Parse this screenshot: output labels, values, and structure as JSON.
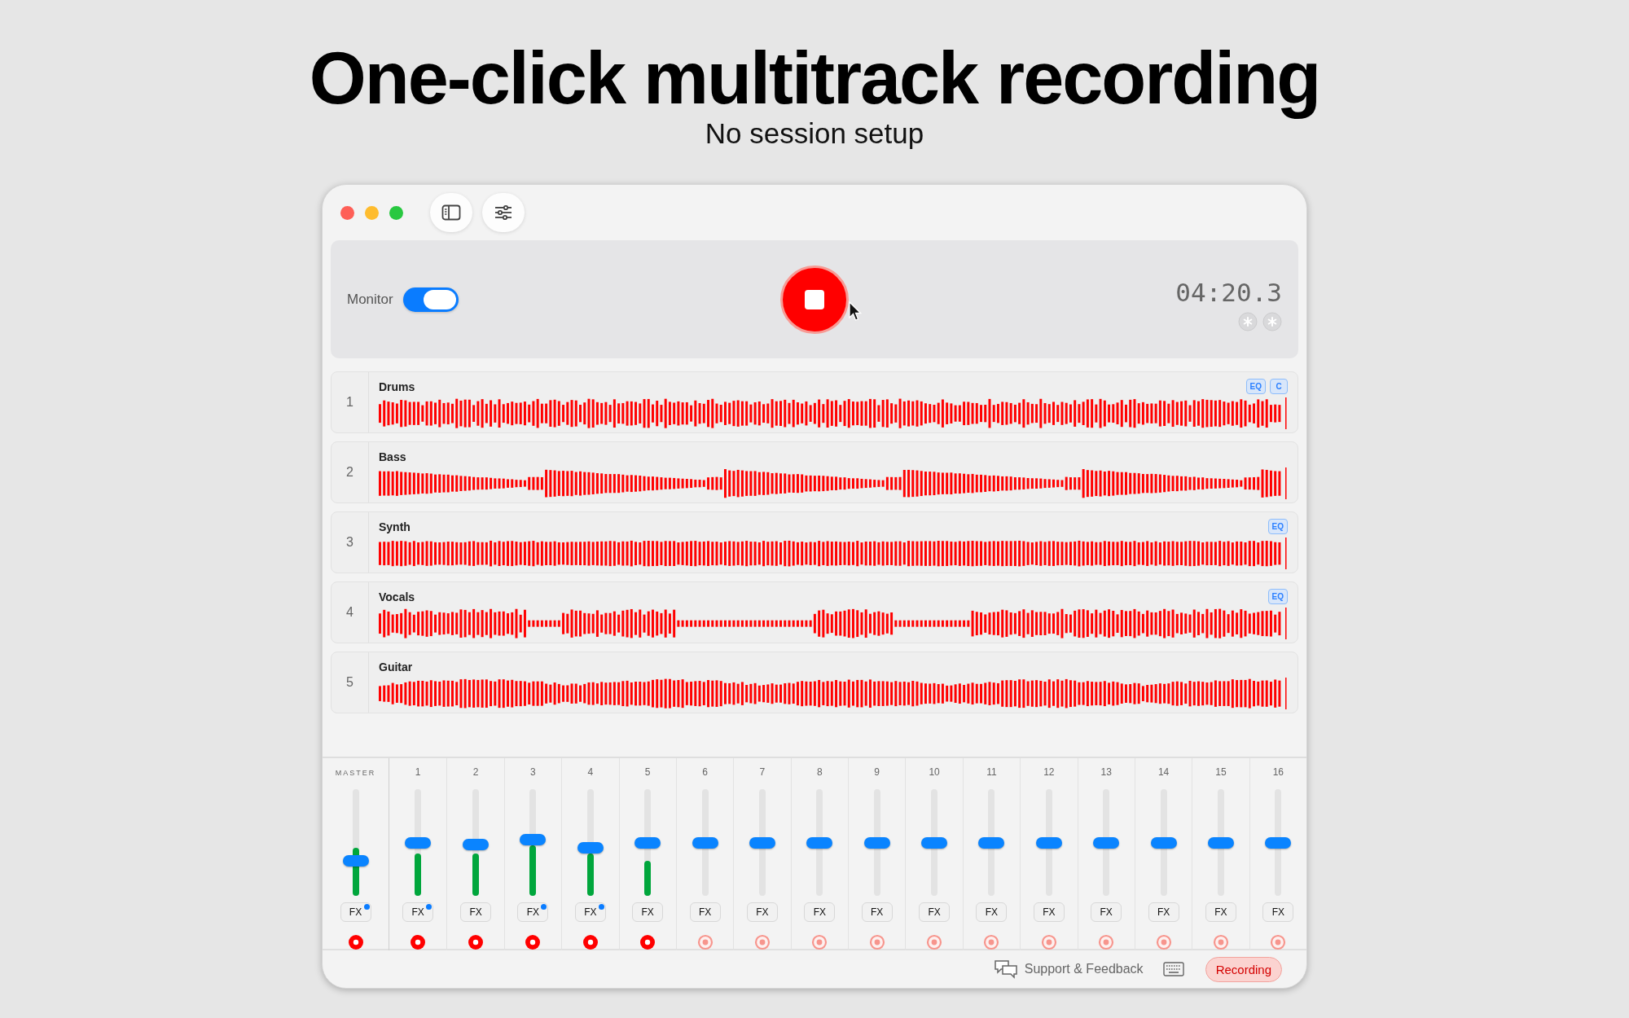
{
  "headline": "One-click multitrack recording",
  "subtitle": "No session setup",
  "transport": {
    "monitor": {
      "label": "Monitor",
      "on": true
    },
    "recording": true,
    "time": "04:20.3"
  },
  "tracks": [
    {
      "number": "1",
      "name": "Drums",
      "badges": [
        "EQ",
        "C"
      ]
    },
    {
      "number": "2",
      "name": "Bass"
    },
    {
      "number": "3",
      "name": "Synth",
      "badges": [
        "EQ"
      ]
    },
    {
      "number": "4",
      "name": "Vocals",
      "badges": [
        "EQ"
      ]
    },
    {
      "number": "5",
      "name": "Guitar"
    }
  ],
  "mixer": {
    "channels": [
      {
        "kind": "master",
        "label": "MASTER",
        "level": 0.33,
        "meter": {
          "level": 0.45
        },
        "fx": "FX",
        "fx_active": true,
        "armed": true
      },
      {
        "kind": "track",
        "label": "1",
        "level": 0.5,
        "meter": {
          "level": 0.4
        },
        "fx": "FX",
        "fx_active": true,
        "armed": true
      },
      {
        "kind": "track",
        "label": "2",
        "level": 0.48,
        "meter": {
          "level": 0.4
        },
        "fx": "FX",
        "fx_active": false,
        "armed": true
      },
      {
        "kind": "track",
        "label": "3",
        "level": 0.53,
        "meter": {
          "level": 0.47
        },
        "fx": "FX",
        "fx_active": true,
        "armed": true
      },
      {
        "kind": "track",
        "label": "4",
        "level": 0.45,
        "meter": {
          "level": 0.4
        },
        "fx": "FX",
        "fx_active": true,
        "armed": true
      },
      {
        "kind": "track",
        "label": "5",
        "level": 0.5,
        "meter": {
          "level": 0.33
        },
        "fx": "FX",
        "fx_active": false,
        "armed": true
      },
      {
        "kind": "track",
        "label": "6",
        "level": 0.5,
        "fx": "FX",
        "fx_active": false,
        "armed": false
      },
      {
        "kind": "track",
        "label": "7",
        "level": 0.5,
        "fx": "FX",
        "fx_active": false,
        "armed": false
      },
      {
        "kind": "track",
        "label": "8",
        "level": 0.5,
        "fx": "FX",
        "fx_active": false,
        "armed": false
      },
      {
        "kind": "track",
        "label": "9",
        "level": 0.5,
        "fx": "FX",
        "fx_active": false,
        "armed": false
      },
      {
        "kind": "track",
        "label": "10",
        "level": 0.5,
        "fx": "FX",
        "fx_active": false,
        "armed": false
      },
      {
        "kind": "track",
        "label": "11",
        "level": 0.5,
        "fx": "FX",
        "fx_active": false,
        "armed": false
      },
      {
        "kind": "track",
        "label": "12",
        "level": 0.5,
        "fx": "FX",
        "fx_active": false,
        "armed": false
      },
      {
        "kind": "track",
        "label": "13",
        "level": 0.5,
        "fx": "FX",
        "fx_active": false,
        "armed": false
      },
      {
        "kind": "track",
        "label": "14",
        "level": 0.5,
        "fx": "FX",
        "fx_active": false,
        "armed": false
      },
      {
        "kind": "track",
        "label": "15",
        "level": 0.5,
        "fx": "FX",
        "fx_active": false,
        "armed": false
      },
      {
        "kind": "track",
        "label": "16",
        "level": 0.5,
        "fx": "FX",
        "fx_active": false,
        "armed": false
      }
    ]
  },
  "footer": {
    "support": "Support & Feedback",
    "status": "Recording"
  }
}
